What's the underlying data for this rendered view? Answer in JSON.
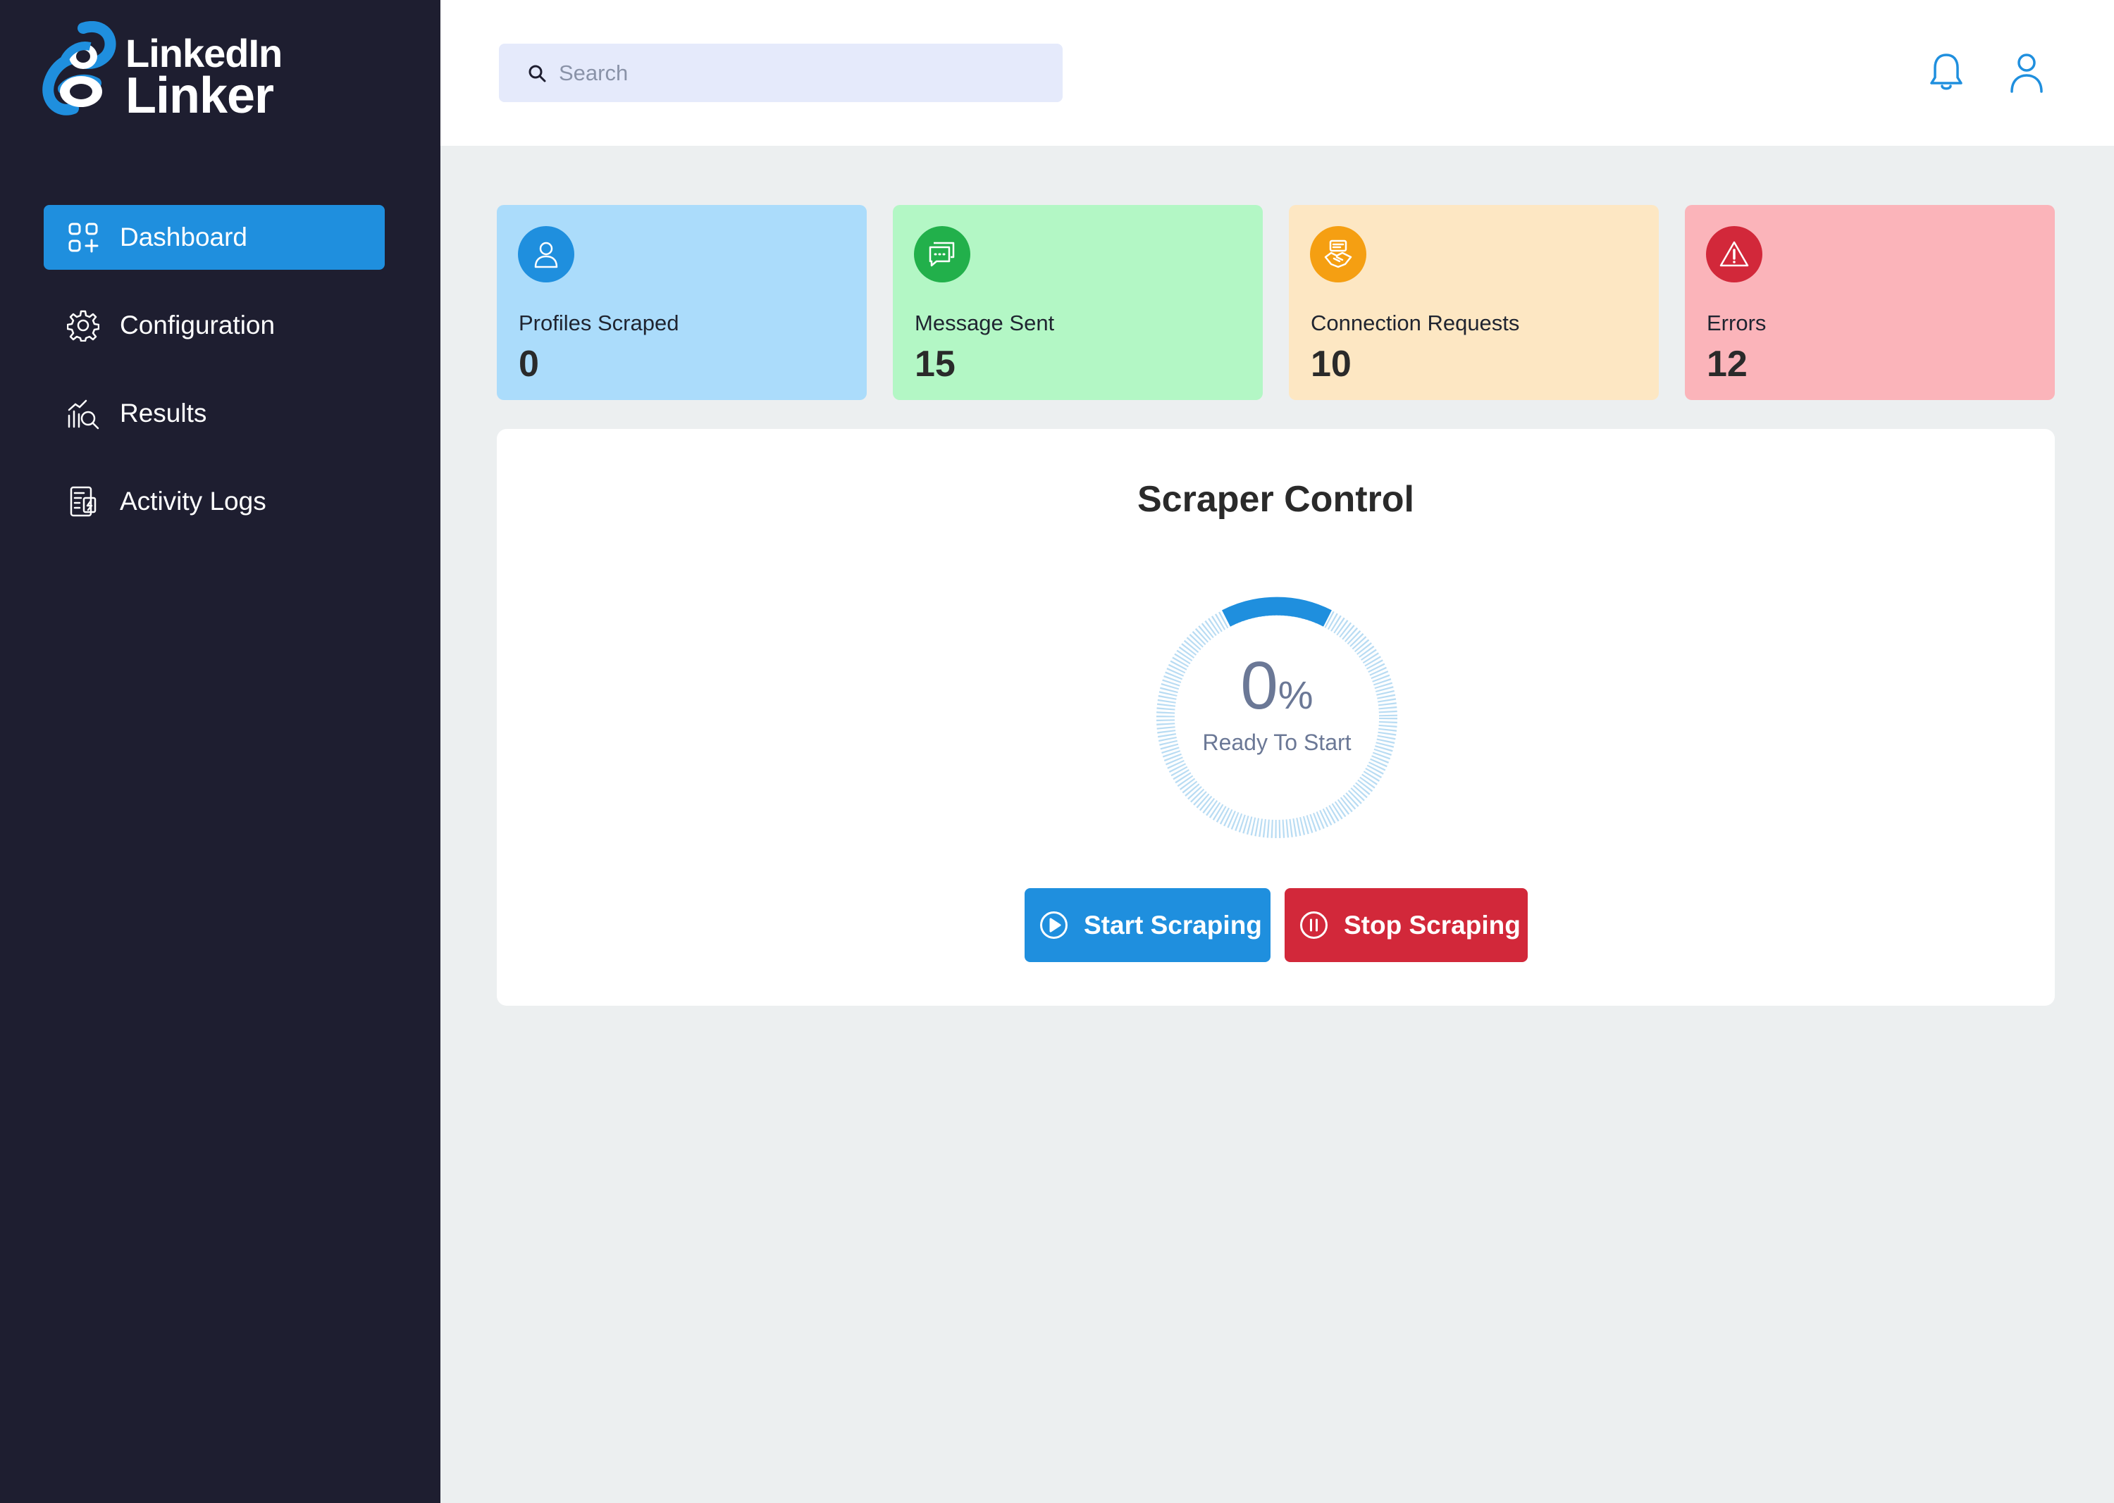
{
  "app": {
    "logo_line1": "LinkedIn",
    "logo_line2": "Linker",
    "logo_icon": "chain-link-icon",
    "brand_color": "#1f8fde"
  },
  "sidebar": {
    "items": [
      {
        "label": "Dashboard",
        "icon": "dashboard-grid-icon",
        "active": true
      },
      {
        "label": "Configuration",
        "icon": "gear-icon",
        "active": false
      },
      {
        "label": "Results",
        "icon": "chart-search-icon",
        "active": false
      },
      {
        "label": "Activity Logs",
        "icon": "activity-log-icon",
        "active": false
      }
    ]
  },
  "header": {
    "search": {
      "placeholder": "Search",
      "value": ""
    },
    "icons": [
      "bell-icon",
      "user-icon"
    ]
  },
  "stats": [
    {
      "label": "Profiles Scraped",
      "value": "0",
      "icon": "user-icon",
      "bg": "#abdcfb",
      "icon_bg": "#1f8fde"
    },
    {
      "label": "Message Sent",
      "value": "15",
      "icon": "message-icon",
      "bg": "#b3f7c5",
      "icon_bg": "#22b04b"
    },
    {
      "label": "Connection Requests",
      "value": "10",
      "icon": "handshake-icon",
      "bg": "#fde7c3",
      "icon_bg": "#f59f12"
    },
    {
      "label": "Errors",
      "value": "12",
      "icon": "warning-icon",
      "bg": "#fbb4ba",
      "icon_bg": "#d2283a"
    }
  ],
  "scraper": {
    "title": "Scraper Control",
    "progress_value": "0",
    "progress_unit": "%",
    "status": "Ready To Start",
    "start_label": "Start Scraping",
    "stop_label": "Stop Scraping",
    "start_color": "#1f8fde",
    "stop_color": "#d2283a"
  }
}
